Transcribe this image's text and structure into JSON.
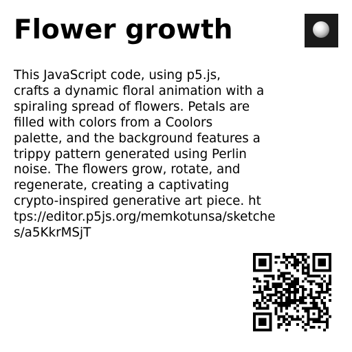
{
  "title": "Flower growth",
  "thumbnail": {
    "icon": "white-sphere-preview",
    "background": "#1a1a1a"
  },
  "description_lines": [
    "This JavaScript code, using p5.js,",
    "crafts a dynamic floral animation with a",
    "spiraling spread of flowers. Petals are",
    "filled with colors from a Coolors",
    "palette, and the background features a",
    "trippy pattern generated using Perlin",
    "noise. The flowers grow, rotate, and",
    "regenerate, creating a captivating",
    "crypto-inspired generative art piece. ht",
    "tps://editor.p5js.org/memkotunsa/sketche",
    "s/a5KkrMSjT"
  ],
  "qr_code": {
    "icon": "qr-code"
  }
}
